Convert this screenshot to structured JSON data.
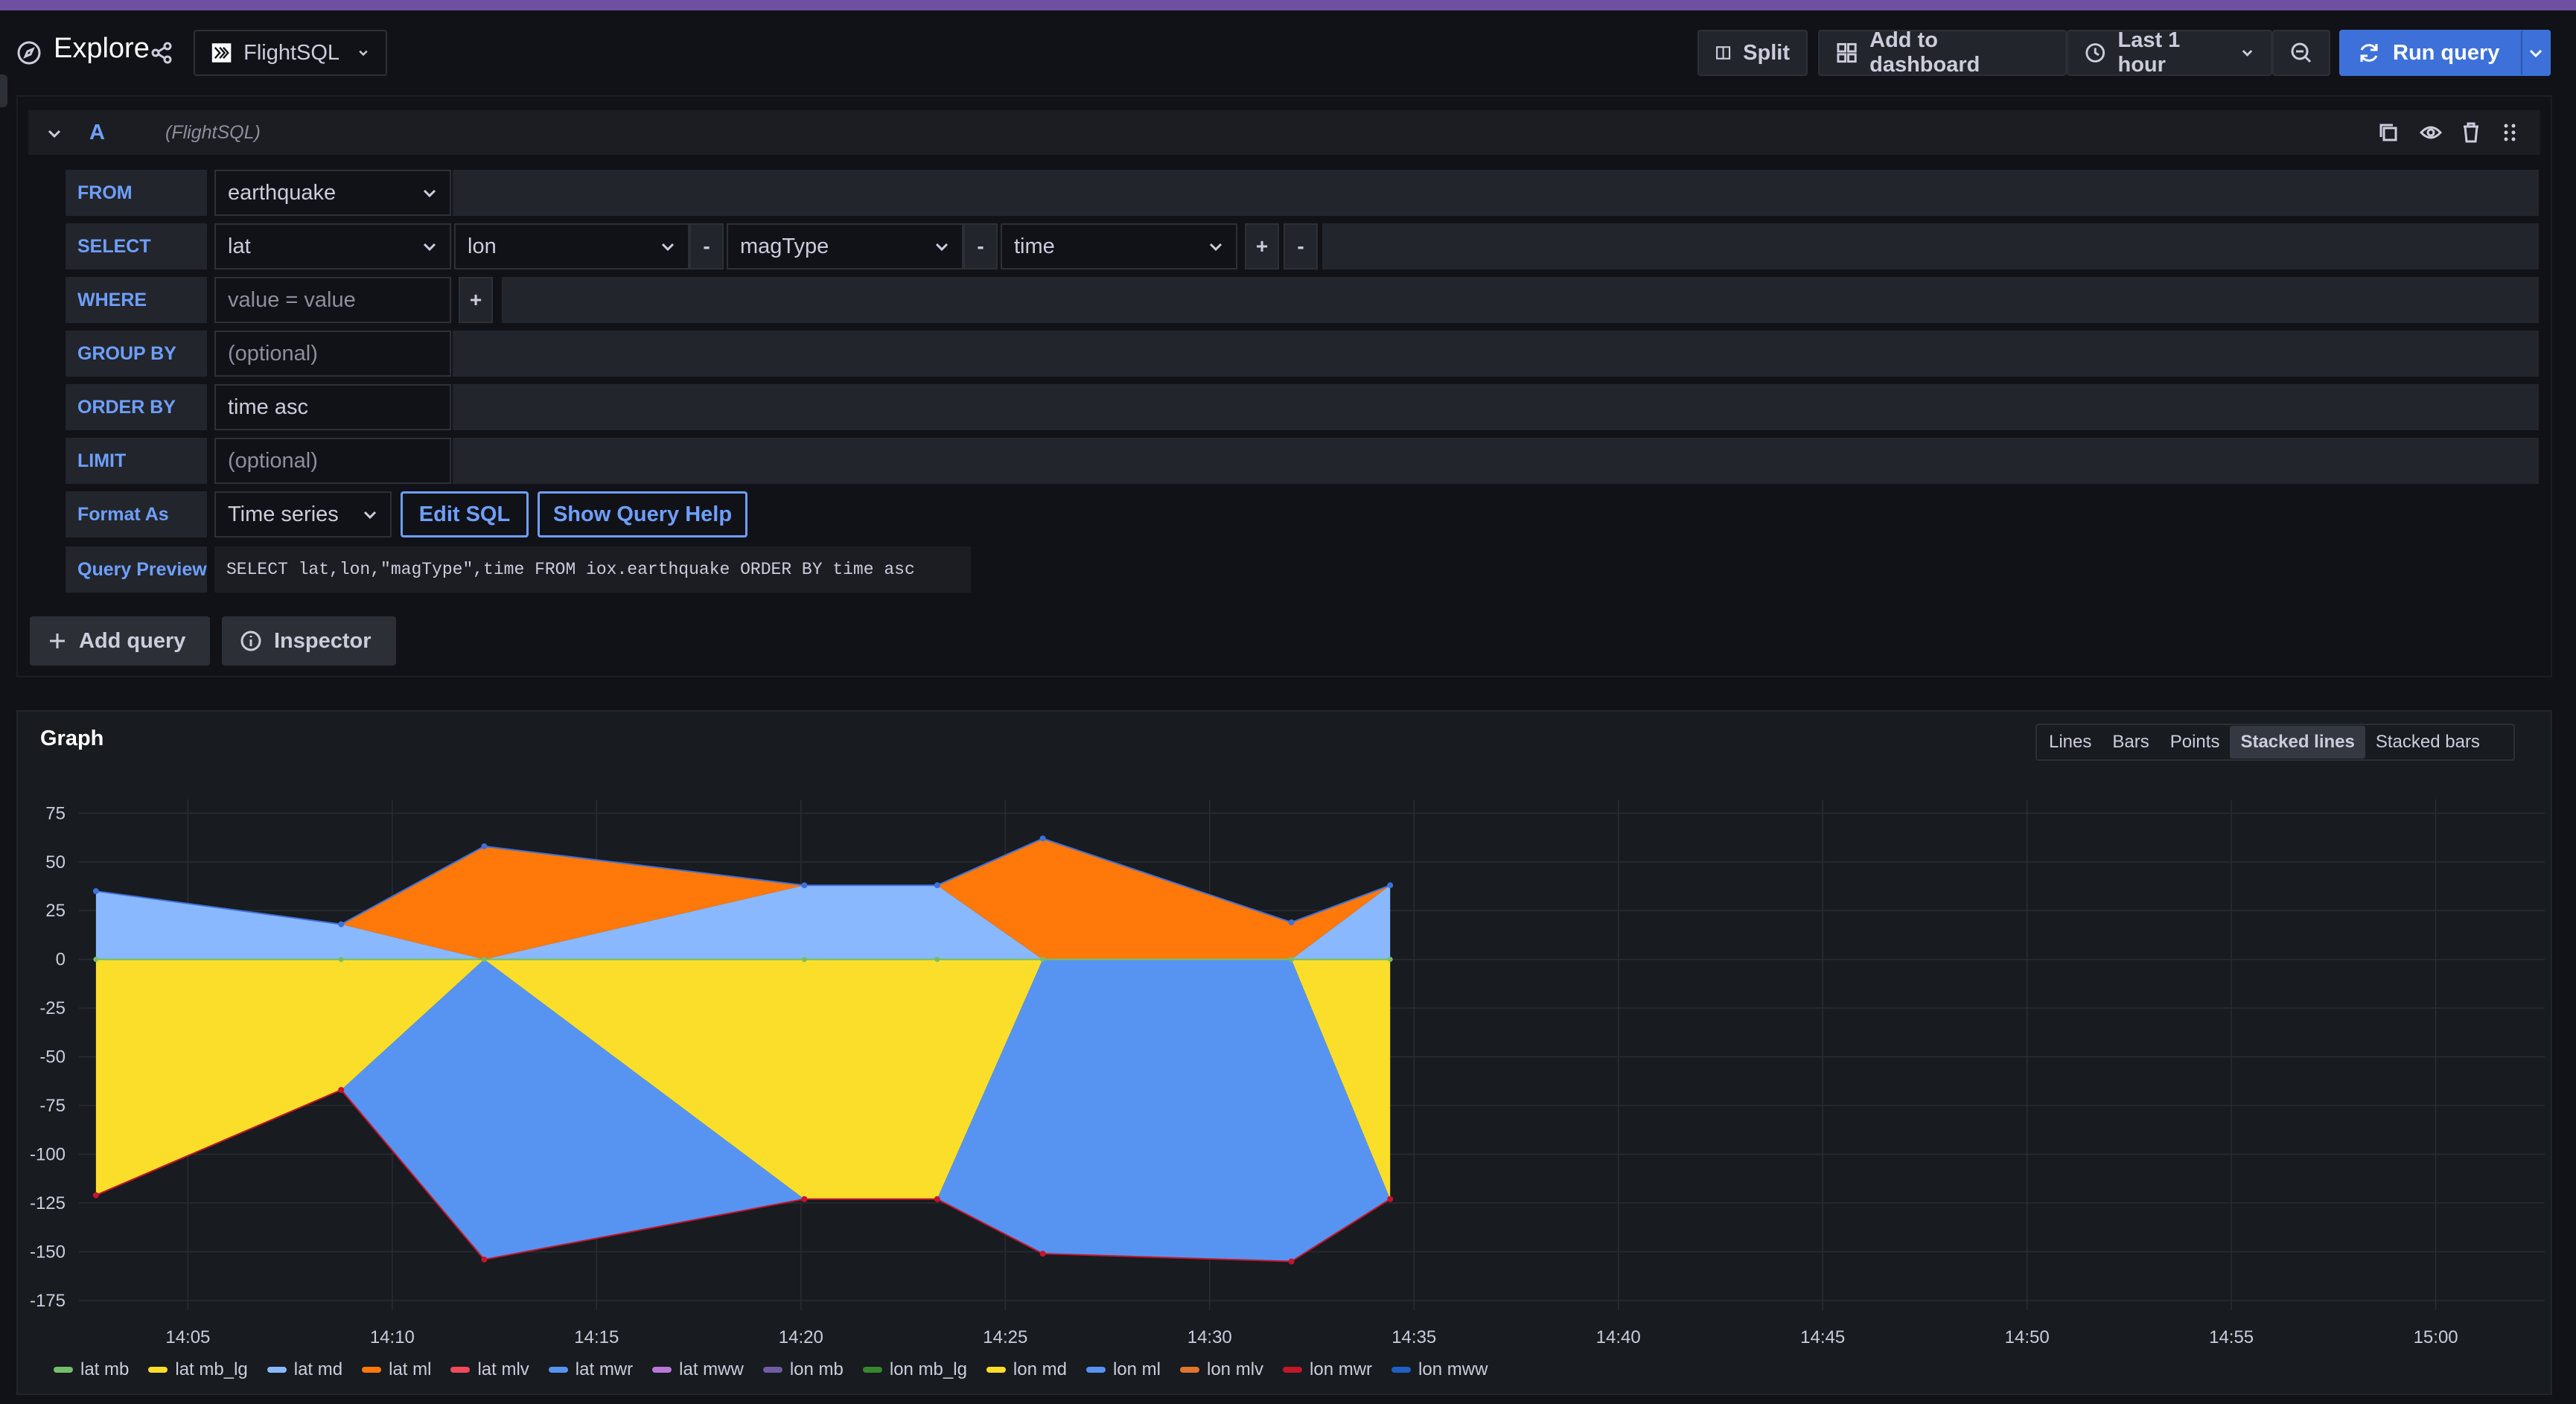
{
  "header": {
    "title": "Explore",
    "datasource": "FlightSQL",
    "split_label": "Split",
    "add_dashboard_label": "Add to dashboard",
    "time_range_label": "Last 1 hour",
    "run_query_label": "Run query"
  },
  "query": {
    "ref_id": "A",
    "datasource_hint": "(FlightSQL)",
    "from_label": "FROM",
    "from_value": "earthquake",
    "select_label": "SELECT",
    "select_columns": [
      "lat",
      "lon",
      "magType",
      "time"
    ],
    "where_label": "WHERE",
    "where_placeholder": "value = value",
    "groupby_label": "GROUP BY",
    "groupby_placeholder": "(optional)",
    "orderby_label": "ORDER BY",
    "orderby_value": "time asc",
    "limit_label": "LIMIT",
    "limit_placeholder": "(optional)",
    "format_label": "Format As",
    "format_value": "Time series",
    "edit_sql_label": "Edit SQL",
    "query_help_label": "Show Query Help",
    "preview_label": "Query Preview",
    "preview_sql": "SELECT lat,lon,\"magType\",time FROM iox.earthquake ORDER BY time asc"
  },
  "actions": {
    "add_query_label": "Add query",
    "inspector_label": "Inspector"
  },
  "graph": {
    "title": "Graph",
    "viz_tabs": [
      "Lines",
      "Bars",
      "Points",
      "Stacked lines",
      "Stacked bars"
    ],
    "active_tab": "Stacked lines"
  },
  "chart_data": {
    "type": "area",
    "stacked": true,
    "x_ticks": [
      "14:05",
      "14:10",
      "14:15",
      "14:20",
      "14:25",
      "14:30",
      "14:35",
      "14:40",
      "14:45",
      "14:50",
      "14:55",
      "15:00"
    ],
    "y_ticks": [
      75,
      50,
      25,
      0,
      -25,
      -50,
      -75,
      -100,
      -125,
      -150,
      -175
    ],
    "ylim": [
      -180,
      82
    ],
    "x_minutes_range": [
      "14:02:20",
      "15:02:40"
    ],
    "points_time": [
      "14:02:45",
      "14:08:45",
      "14:12:15",
      "14:20:05",
      "14:23:20",
      "14:25:55",
      "14:32:00",
      "14:34:25"
    ],
    "series": [
      {
        "name": "lat md",
        "color": "#8ab8ff",
        "values": [
          35,
          18,
          0,
          38,
          38,
          0,
          0,
          38
        ]
      },
      {
        "name": "lat ml",
        "color": "#ff780a",
        "values": [
          0,
          0,
          58,
          0,
          0,
          62,
          19,
          0
        ]
      },
      {
        "name": "lon md",
        "color": "#fade2a",
        "values": [
          -121,
          -67,
          0,
          -123,
          -123,
          0,
          0,
          -123
        ]
      },
      {
        "name": "lon ml",
        "color": "#5794f2",
        "values": [
          0,
          0,
          -154,
          0,
          0,
          -151,
          -155,
          0
        ]
      }
    ],
    "legend": [
      {
        "name": "lat mb",
        "color": "#73bf69"
      },
      {
        "name": "lat mb_lg",
        "color": "#fade2a"
      },
      {
        "name": "lat md",
        "color": "#8ab8ff"
      },
      {
        "name": "lat ml",
        "color": "#ff780a"
      },
      {
        "name": "lat mlv",
        "color": "#f2495c"
      },
      {
        "name": "lat mwr",
        "color": "#5794f2"
      },
      {
        "name": "lat mww",
        "color": "#b877d9"
      },
      {
        "name": "lon mb",
        "color": "#705da0"
      },
      {
        "name": "lon mb_lg",
        "color": "#37872d"
      },
      {
        "name": "lon md",
        "color": "#fade2a"
      },
      {
        "name": "lon ml",
        "color": "#5794f2"
      },
      {
        "name": "lon mlv",
        "color": "#e0752d"
      },
      {
        "name": "lon mwr",
        "color": "#c4162a"
      },
      {
        "name": "lon mww",
        "color": "#1f60c4"
      }
    ]
  }
}
